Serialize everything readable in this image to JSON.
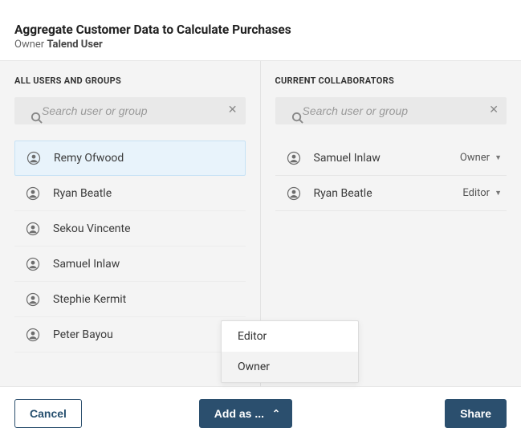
{
  "header": {
    "title": "Aggregate Customer Data to Calculate Purchases",
    "owner_label": "Owner",
    "owner_name": "Talend User"
  },
  "left": {
    "section_label": "ALL USERS AND GROUPS",
    "search_placeholder": "Search user or group",
    "users": [
      {
        "name": "Remy Ofwood",
        "selected": true
      },
      {
        "name": "Ryan Beatle"
      },
      {
        "name": "Sekou Vincente"
      },
      {
        "name": "Samuel Inlaw"
      },
      {
        "name": "Stephie Kermit"
      },
      {
        "name": "Peter Bayou"
      }
    ]
  },
  "right": {
    "section_label": "CURRENT COLLABORATORS",
    "search_placeholder": "Search user or group",
    "collaborators": [
      {
        "name": "Samuel Inlaw",
        "role": "Owner"
      },
      {
        "name": "Ryan Beatle",
        "role": "Editor"
      }
    ]
  },
  "menu": {
    "items": [
      {
        "label": "Editor"
      },
      {
        "label": "Owner",
        "hover": true
      }
    ]
  },
  "footer": {
    "cancel": "Cancel",
    "add_as": "Add as ...",
    "share": "Share"
  }
}
